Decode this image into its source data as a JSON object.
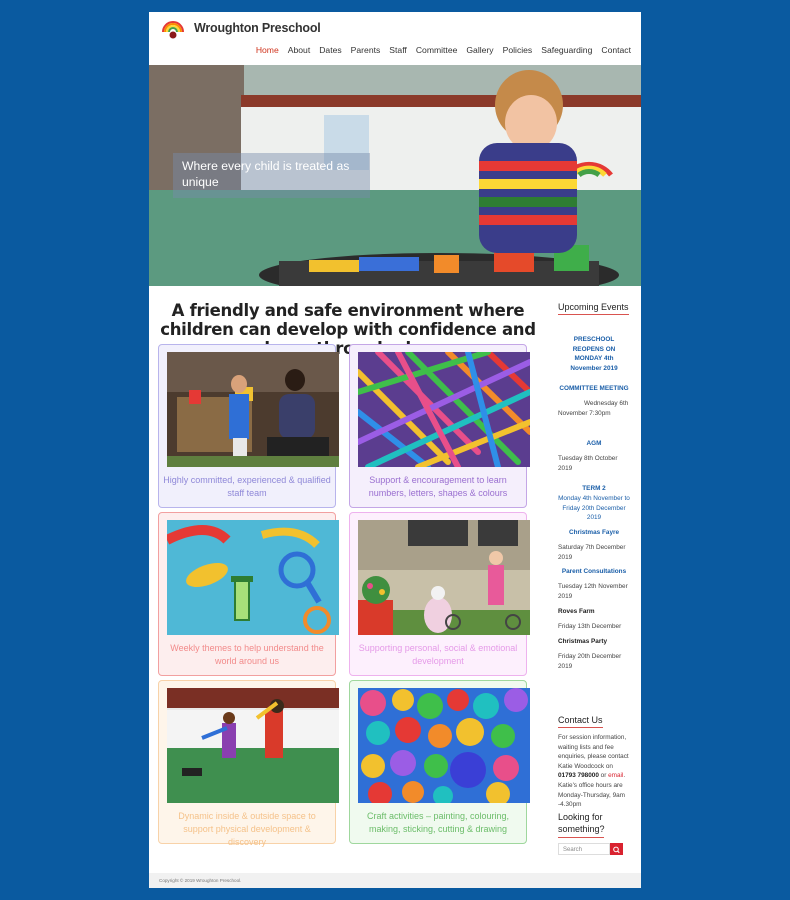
{
  "site": {
    "title": "Wroughton Preschool"
  },
  "nav": [
    "Home",
    "About",
    "Dates",
    "Parents",
    "Staff",
    "Committee",
    "Gallery",
    "Policies",
    "Safeguarding",
    "Contact"
  ],
  "hero": {
    "tagline": "Where every child is treated as unique"
  },
  "main": {
    "headline": "A friendly and safe environment where children can develop with confidence and learn through play",
    "tiles": [
      {
        "caption": "Highly committed, experienced & qualified staff team",
        "color": "#8f88d8"
      },
      {
        "caption": "Support & encouragement to learn numbers, letters, shapes & colours",
        "color": "#9a6fd0"
      },
      {
        "caption": "Weekly themes to help understand the world around us",
        "color": "#f28b8b"
      },
      {
        "caption": "Supporting personal, social & emotional development",
        "color": "#e59ae8"
      },
      {
        "caption": "Dynamic inside & outside space to support physical development & discovery",
        "color": "#f5c28a"
      },
      {
        "caption": "Craft activities – painting, colouring, making, sticking, cutting & drawing",
        "color": "#6cbd6a"
      }
    ]
  },
  "sidebar": {
    "events_title": "Upcoming Events",
    "events": {
      "e1_title": "PRESCHOOL REOPENS ON MONDAY 4th November 2019",
      "e2_title": "COMMITTEE MEETING",
      "e2_date": "Wednesday 6th November 7:30pm",
      "e3_title": "AGM",
      "e3_date": "Tuesday 8th October 2019",
      "e4_title": "TERM 2",
      "e4_date": "Monday 4th November to Friday 20th December 2019",
      "e5_title": "Christmas Fayre",
      "e5_date": "Saturday 7th December 2019",
      "e6_title": "Parent Consultations",
      "e6_date": "Tuesday 12th November 2019",
      "e7_title": "Roves Farm",
      "e7_date": "Friday 13th December",
      "e8_title": "Christmas Party",
      "e8_date": "Friday 20th December 2019"
    },
    "contact_title": "Contact Us",
    "contact": {
      "p1": "For session information, waiting lists and fee enquiries, please contact Katie Woodcock on ",
      "phone": "01793 798000",
      "p2": " or ",
      "email": "email",
      "p3": ". Katie's office hours are Monday-Thursday, 9am -4.30pm"
    },
    "search_title": "Looking for something?",
    "search_placeholder": "Search"
  },
  "footer": {
    "copyright": "Copyright © 2019 Wroughton Preschool."
  },
  "colors": {
    "accent": "#d0341d",
    "background": "#0a5aa0",
    "link": "#1a5ea8"
  }
}
